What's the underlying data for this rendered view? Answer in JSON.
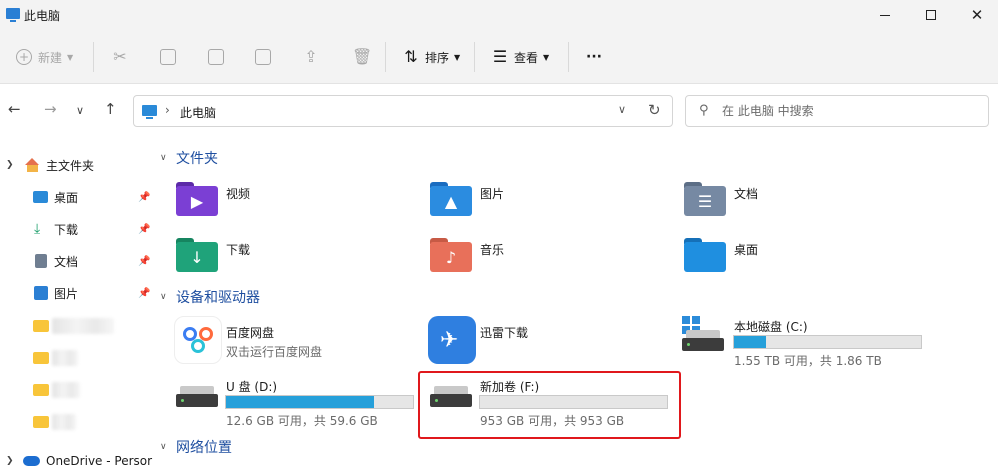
{
  "window": {
    "title": "此电脑"
  },
  "toolbar": {
    "new_label": "新建",
    "sort_label": "排序",
    "view_label": "查看",
    "more_label": "···"
  },
  "address": {
    "crumb": "此电脑"
  },
  "search": {
    "placeholder": "在 此电脑 中搜索"
  },
  "nav": {
    "home": "主文件夹",
    "items": [
      {
        "label": "桌面",
        "icon": "desktop-icon",
        "color": "#2a8ad8"
      },
      {
        "label": "下载",
        "icon": "download-icon",
        "color": "#1b9e6b"
      },
      {
        "label": "文档",
        "icon": "document-icon",
        "color": "#6f7e91"
      },
      {
        "label": "图片",
        "icon": "picture-icon",
        "color": "#2b7fd3"
      }
    ],
    "onedrive": "OneDrive - Persor"
  },
  "sections": {
    "folders": "文件夹",
    "devices": "设备和驱动器",
    "network": "网络位置"
  },
  "folders": [
    {
      "label": "视频",
      "icon": "video-folder-icon",
      "color": "#7b3fd4"
    },
    {
      "label": "图片",
      "icon": "picture-folder-icon",
      "color": "#2b8ce0"
    },
    {
      "label": "文档",
      "icon": "document-folder-icon",
      "color": "#7689a3"
    },
    {
      "label": "下载",
      "icon": "download-folder-icon",
      "color": "#1fa37a"
    },
    {
      "label": "音乐",
      "icon": "music-folder-icon",
      "color": "#e8705a"
    },
    {
      "label": "桌面",
      "icon": "desktop-folder-icon",
      "color": "#1f8fe0"
    }
  ],
  "devices": [
    {
      "name": "百度网盘",
      "sub": "双击运行百度网盘",
      "icon": "baidu-netdisk-icon"
    },
    {
      "name": "迅雷下载",
      "icon": "xunlei-icon",
      "color": "#2f7fe0"
    },
    {
      "name": "本地磁盘 (C:)",
      "sub": "1.55 TB 可用，共 1.86 TB",
      "used_fraction": 0.17,
      "icon": "windows-drive-icon"
    },
    {
      "name": "U 盘 (D:)",
      "sub": "12.6 GB 可用，共 59.6 GB",
      "used_fraction": 0.79,
      "icon": "usb-drive-icon"
    },
    {
      "name": "新加卷 (F:)",
      "sub": "953 GB 可用，共 953 GB",
      "used_fraction": 0.0,
      "icon": "drive-icon"
    }
  ],
  "colors": {
    "accent": "#26a0da",
    "section": "#1f4fa0",
    "highlight": "#e0181c"
  }
}
